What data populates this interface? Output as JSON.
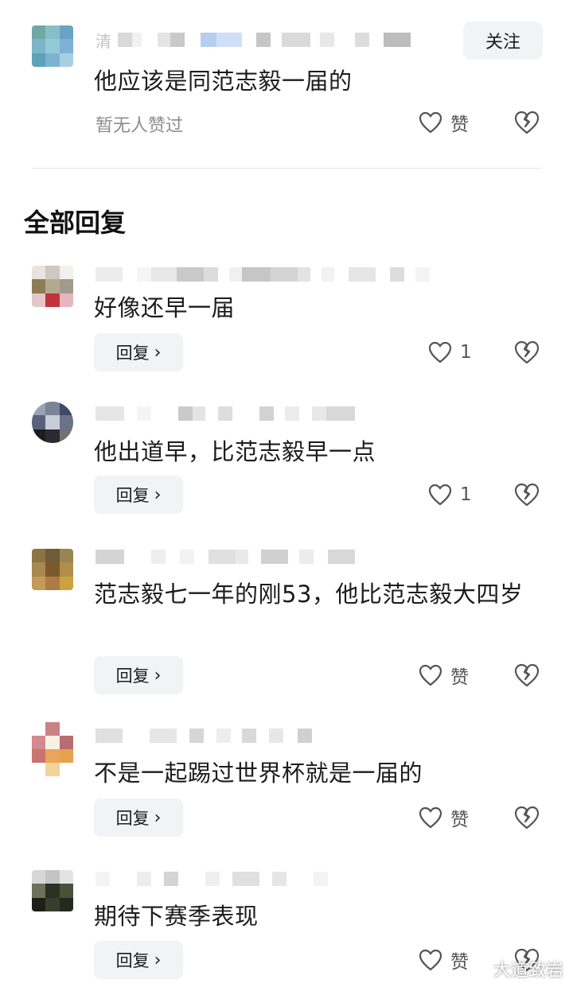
{
  "top_comment": {
    "username_visible": "清",
    "text": "他应该是同范志毅一届的",
    "likes_status": "暂无人赞过",
    "like_label": "赞",
    "follow_label": "关注"
  },
  "section_title": "全部回复",
  "replies": [
    {
      "text": "好像还早一届",
      "like_label": "1",
      "reply_label": "回复",
      "reply_chevron": "›"
    },
    {
      "text": "他出道早，比范志毅早一点",
      "like_label": "1",
      "reply_label": "回复",
      "reply_chevron": "›"
    },
    {
      "text": "范志毅七一年的刚53，他比范志毅大四岁",
      "like_label": "赞",
      "reply_label": "回复",
      "reply_chevron": "›"
    },
    {
      "text": "不是一起踢过世界杯就是一届的",
      "like_label": "赞",
      "reply_label": "回复",
      "reply_chevron": "›"
    },
    {
      "text": "期待下赛季表现",
      "like_label": "赞",
      "reply_label": "回复",
      "reply_chevron": "›"
    }
  ],
  "watermark": "大道致岩",
  "icons": {
    "like": "heart-outline-icon",
    "dislike": "broken-heart-icon",
    "reply_arrow": "chevron-right-icon"
  },
  "colors": {
    "button_bg": "#f2f3f5",
    "meta_text": "#8c8c8c",
    "divider": "#e6e6e6"
  }
}
